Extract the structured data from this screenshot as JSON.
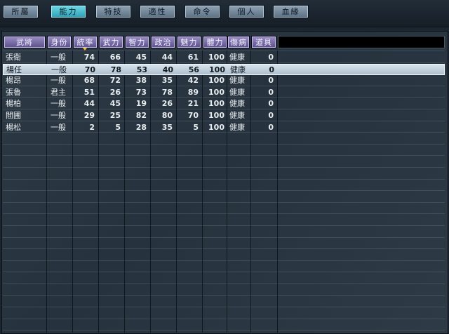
{
  "tabs": [
    {
      "label": "所屬",
      "active": false
    },
    {
      "label": "能力",
      "active": true
    },
    {
      "label": "特技",
      "active": false
    },
    {
      "label": "適性",
      "active": false
    },
    {
      "label": "命令",
      "active": false
    },
    {
      "label": "個人",
      "active": false
    },
    {
      "label": "血緣",
      "active": false
    }
  ],
  "columns": [
    "武將",
    "身份",
    "統率",
    "武力",
    "智力",
    "政治",
    "魅力",
    "體力",
    "傷病",
    "道具"
  ],
  "sorted_column": "統率",
  "rows": [
    {
      "name": "張衛",
      "rank": "一般",
      "lead": "74",
      "war": "66",
      "int": "45",
      "pol": "44",
      "cha": "61",
      "hp": "100",
      "cond": "健康",
      "items": "0",
      "selected": false
    },
    {
      "name": "楊任",
      "rank": "一般",
      "lead": "70",
      "war": "78",
      "int": "53",
      "pol": "40",
      "cha": "56",
      "hp": "100",
      "cond": "健康",
      "items": "0",
      "selected": true
    },
    {
      "name": "楊昂",
      "rank": "一般",
      "lead": "68",
      "war": "72",
      "int": "38",
      "pol": "35",
      "cha": "42",
      "hp": "100",
      "cond": "健康",
      "items": "0",
      "selected": false
    },
    {
      "name": "張魯",
      "rank": "君主",
      "lead": "51",
      "war": "26",
      "int": "73",
      "pol": "78",
      "cha": "89",
      "hp": "100",
      "cond": "健康",
      "items": "0",
      "selected": false
    },
    {
      "name": "楊柏",
      "rank": "一般",
      "lead": "44",
      "war": "45",
      "int": "19",
      "pol": "26",
      "cha": "21",
      "hp": "100",
      "cond": "健康",
      "items": "0",
      "selected": false
    },
    {
      "name": "閻圃",
      "rank": "一般",
      "lead": "29",
      "war": "25",
      "int": "82",
      "pol": "80",
      "cha": "70",
      "hp": "100",
      "cond": "健康",
      "items": "0",
      "selected": false
    },
    {
      "name": "楊松",
      "rank": "一般",
      "lead": "2",
      "war": "5",
      "int": "28",
      "pol": "35",
      "cha": "5",
      "hp": "100",
      "cond": "健康",
      "items": "0",
      "selected": false
    }
  ]
}
